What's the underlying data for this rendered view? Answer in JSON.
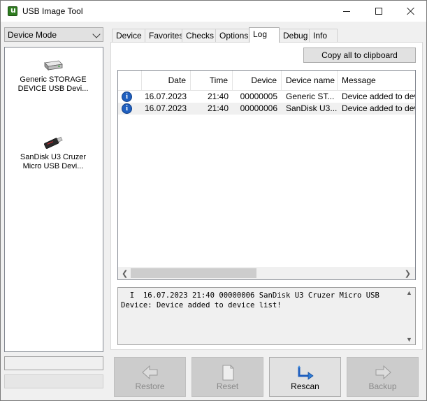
{
  "window": {
    "title": "USB Image Tool"
  },
  "left_panel": {
    "mode_select": "Device Mode",
    "devices": [
      {
        "name_line1": "Generic STORAGE",
        "name_line2": "DEVICE USB Devi...",
        "icon": "hard-drive-icon"
      },
      {
        "name_line1": "SanDisk U3 Cruzer",
        "name_line2": "Micro USB Devi...",
        "icon": "usb-stick-icon"
      }
    ]
  },
  "tabs": [
    {
      "label": "Device",
      "active": false
    },
    {
      "label": "Favorites",
      "active": false
    },
    {
      "label": "Checks",
      "active": false
    },
    {
      "label": "Options",
      "active": false
    },
    {
      "label": "Log",
      "active": true
    },
    {
      "label": "Debug",
      "active": false
    },
    {
      "label": "Info",
      "active": false
    }
  ],
  "log": {
    "copy_button": "Copy all to clipboard",
    "columns": [
      "Date",
      "Time",
      "Device",
      "Device name",
      "Message"
    ],
    "rows": [
      {
        "icon": "info-icon",
        "date": "16.07.2023",
        "time": "21:40",
        "device": "00000005",
        "device_name": "Generic ST...",
        "message": "Device added to device list!"
      },
      {
        "icon": "info-icon",
        "date": "16.07.2023",
        "time": "21:40",
        "device": "00000006",
        "device_name": "SanDisk U3...",
        "message": "Device added to device list!"
      }
    ],
    "detail_text": "  I  16.07.2023 21:40 00000006 SanDisk U3 Cruzer Micro USB Device: Device added to device list!"
  },
  "actions": {
    "restore": {
      "label": "Restore",
      "enabled": false
    },
    "reset": {
      "label": "Reset",
      "enabled": false
    },
    "rescan": {
      "label": "Rescan",
      "enabled": true
    },
    "backup": {
      "label": "Backup",
      "enabled": false
    }
  },
  "colors": {
    "accent_blue": "#1f5fbf",
    "app_icon_green": "#2e7d1f",
    "window_bg": "#f0f0f0"
  }
}
